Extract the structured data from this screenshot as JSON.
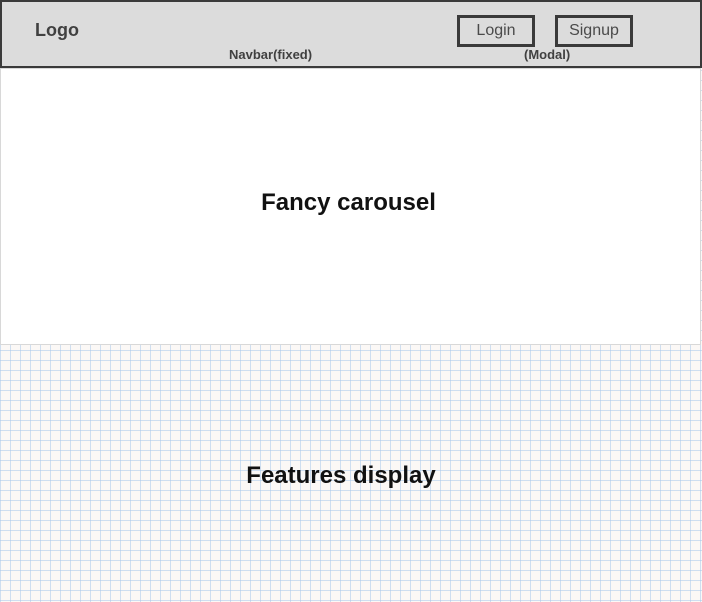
{
  "navbar": {
    "logo": "Logo",
    "caption": "Navbar(fixed)",
    "login_label": "Login",
    "signup_label": "Signup",
    "modal_caption": "(Modal)"
  },
  "carousel": {
    "label": "Fancy carousel"
  },
  "features": {
    "label": "Features display"
  }
}
